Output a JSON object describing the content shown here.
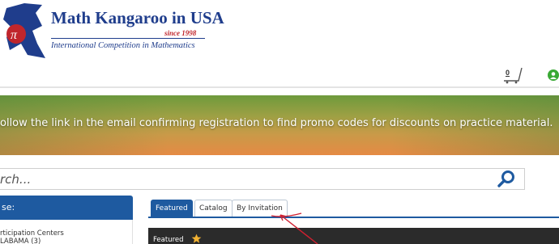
{
  "header": {
    "title": "Math Kangaroo in USA",
    "since": "since 1998",
    "tagline": "International Competition in Mathematics",
    "logo_icon": "pi-kangaroo-logo-icon"
  },
  "cart": {
    "count": "0",
    "icon": "shopping-cart-icon"
  },
  "user_icon": "user-account-icon",
  "banner": {
    "text": "ollow the link in the email confirming registration to find promo codes for discounts on practice material."
  },
  "search": {
    "placeholder": "rch...",
    "icon": "search-icon"
  },
  "sidebar": {
    "header": "se:",
    "items": [
      {
        "label": "rticipation Centers"
      },
      {
        "label": "LABAMA (3)"
      }
    ]
  },
  "tabs": [
    {
      "label": "Featured",
      "active": true
    },
    {
      "label": "Catalog",
      "active": false
    },
    {
      "label": "By Invitation",
      "active": false
    }
  ],
  "featured_panel": {
    "label": "Featured",
    "icon": "star-icon"
  },
  "colors": {
    "brand_blue": "#1e5aa0",
    "logo_navy": "#1f3d8c",
    "logo_red": "#c0262c",
    "panel_dark": "#2b2b2b",
    "annotation_red": "#d02030"
  }
}
